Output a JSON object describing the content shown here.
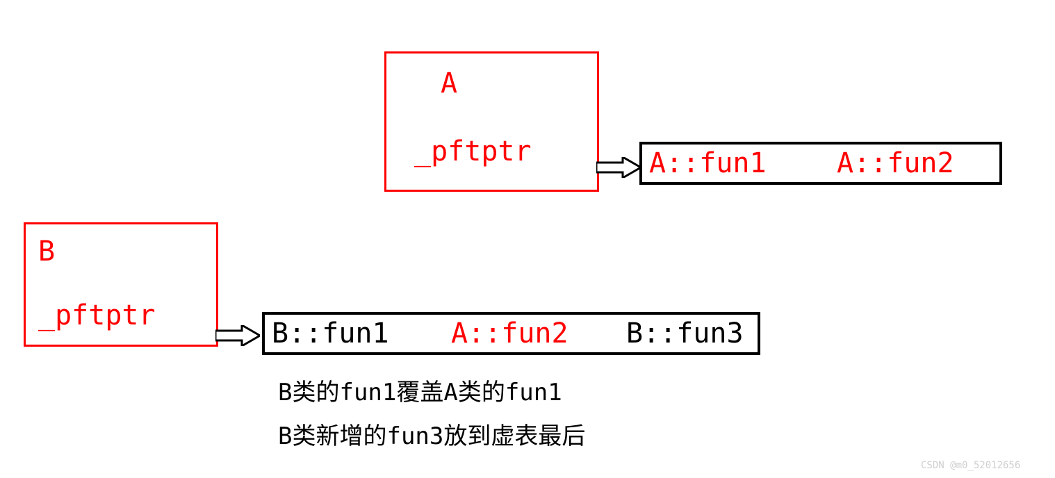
{
  "classA": {
    "name": "A",
    "vptr": "_pftptr",
    "vtable": {
      "entries": [
        {
          "label": "A::fun1",
          "color": "red"
        },
        {
          "label": "A::fun2",
          "color": "red"
        }
      ]
    }
  },
  "classB": {
    "name": "B",
    "vptr": "_pftptr",
    "vtable": {
      "entries": [
        {
          "label": "B::fun1",
          "color": "black"
        },
        {
          "label": "A::fun2",
          "color": "red"
        },
        {
          "label": "B::fun3",
          "color": "black"
        }
      ]
    }
  },
  "notes": {
    "line1": "B类的fun1覆盖A类的fun1",
    "line2": "B类新增的fun3放到虚表最后"
  },
  "watermark": "CSDN @m0_52012656"
}
